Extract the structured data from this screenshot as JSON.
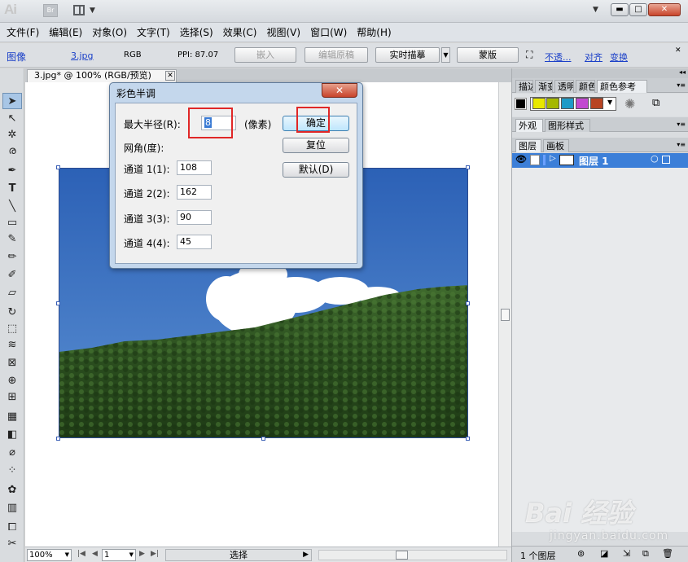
{
  "app": {
    "logo": "Ai",
    "bridge_label": "Br",
    "window_close": "✕",
    "window_min": "▬",
    "window_max": "□"
  },
  "menubar": [
    "文件(F)",
    "编辑(E)",
    "对象(O)",
    "文字(T)",
    "选择(S)",
    "效果(C)",
    "视图(V)",
    "窗口(W)",
    "帮助(H)"
  ],
  "control_bar": {
    "type_label": "图像",
    "file_link": "3.jpg",
    "color_mode": "RGB",
    "ppi": "PPI: 87.07",
    "embed_btn": "嵌入",
    "edit_original_btn": "编辑原稿",
    "live_trace_btn": "实时描摹",
    "mask_btn": "蒙版",
    "opacity_link": "不透...",
    "align_link": "对齐",
    "transform_link": "变换"
  },
  "document": {
    "tab_title": "3.jpg* @ 100% (RGB/预览)",
    "tab_close": "✕"
  },
  "dialog": {
    "title": "彩色半调",
    "close": "✕",
    "max_radius_label": "最大半径(R):",
    "max_radius_value": "8",
    "max_radius_unit": "(像素)",
    "screen_angle_label": "网角(度):",
    "channels": [
      {
        "label": "通道 1(1):",
        "value": "108"
      },
      {
        "label": "通道 2(2):",
        "value": "162"
      },
      {
        "label": "通道 3(3):",
        "value": "90"
      },
      {
        "label": "通道 4(4):",
        "value": "45"
      }
    ],
    "ok_btn": "确定",
    "reset_btn": "复位",
    "default_btn": "默认(D)"
  },
  "right_panel": {
    "top_tabs": [
      "描边",
      "渐变",
      "透明",
      "颜色",
      "颜色参考"
    ],
    "appearance_tabs": [
      "外观",
      "图形样式"
    ],
    "layer_tabs": [
      "图层",
      "画板"
    ],
    "layers": [
      {
        "name": "图层 1"
      }
    ],
    "footer_count": "1 个图层",
    "swatch_colors": [
      "#e8e800",
      "#a5b800",
      "#1e9bc7",
      "#c24ad0",
      "#b84423"
    ]
  },
  "status_bar": {
    "zoom": "100%",
    "page": "1",
    "current_tool": "选择"
  },
  "watermark": {
    "logo": "Bai 经验",
    "url": "jingyan.baidu.com"
  }
}
